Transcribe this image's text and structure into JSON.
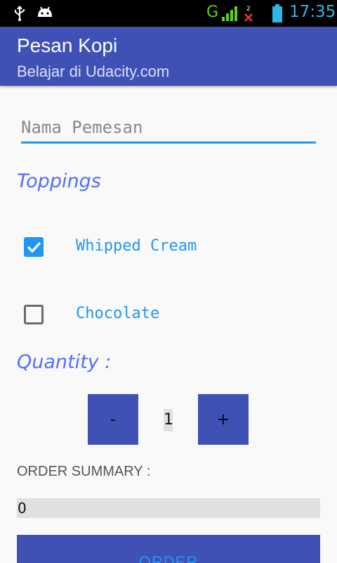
{
  "statusbar": {
    "icons": [
      "usb-icon",
      "android-icon",
      "signal-icon",
      "sms-icon",
      "battery-icon"
    ],
    "network": "G",
    "sms_count": "2",
    "time": "17:35"
  },
  "appbar": {
    "title": "Pesan Kopi",
    "subtitle": "Belajar di Udacity.com",
    "color": "#3f51b5"
  },
  "form": {
    "name_placeholder": "Nama Pemesan",
    "name_value": ""
  },
  "toppings": {
    "label": "Toppings",
    "items": [
      {
        "label": "Whipped Cream",
        "checked": true
      },
      {
        "label": "Chocolate",
        "checked": false
      }
    ]
  },
  "quantity": {
    "label": "Quantity :",
    "minus_label": "-",
    "plus_label": "+",
    "value": "1"
  },
  "summary": {
    "label": "ORDER SUMMARY :",
    "value": "0"
  },
  "order_button": {
    "label": "ORDER"
  },
  "colors": {
    "primary": "#3f51b5",
    "accent": "#2196f3",
    "section_label": "#536dfe"
  }
}
